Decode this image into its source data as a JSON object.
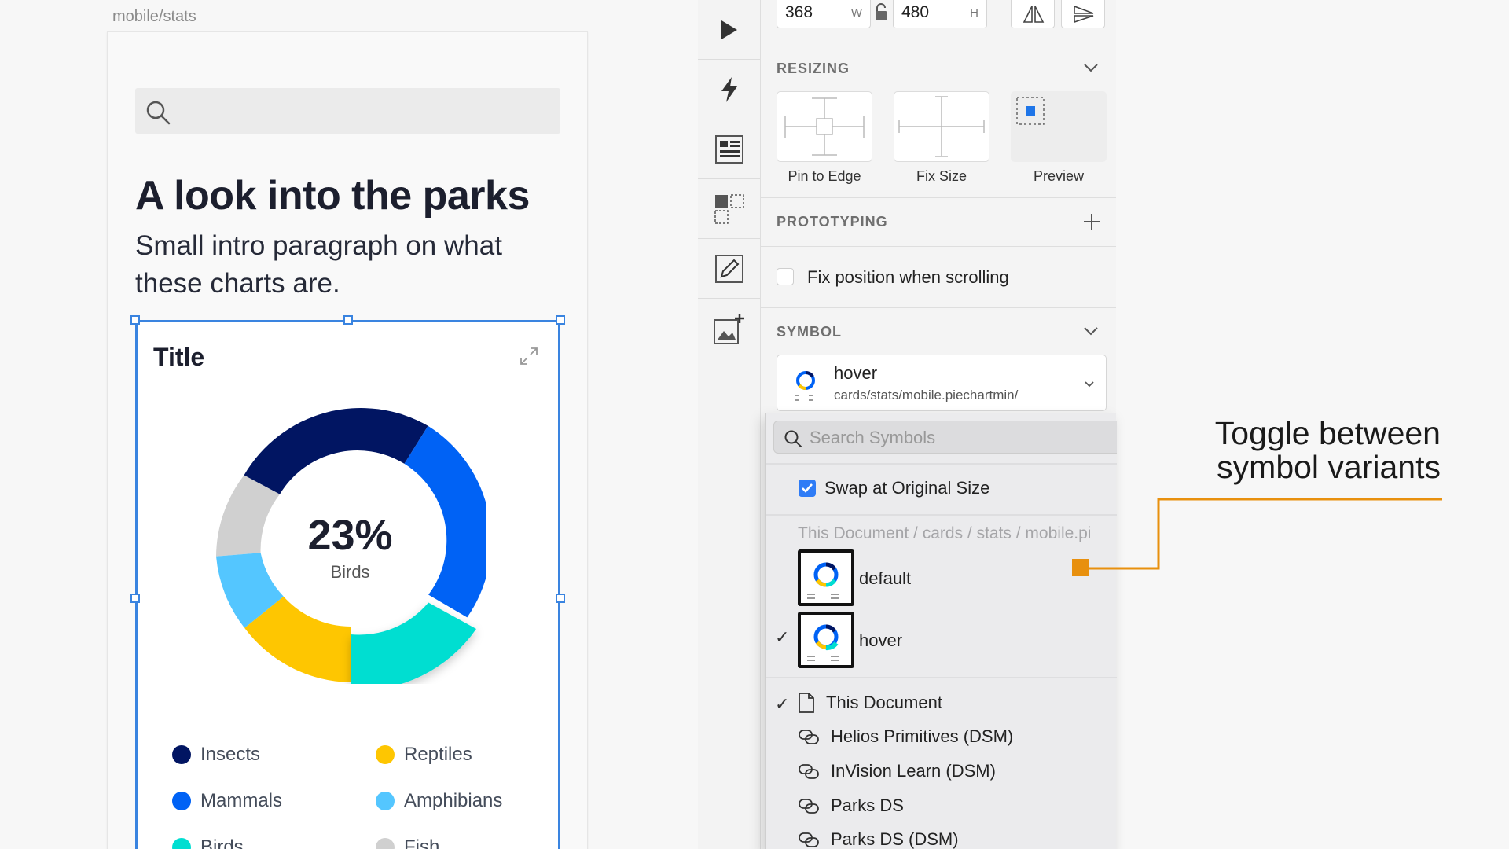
{
  "canvas": {
    "artboard_label": "mobile/stats",
    "page_title": "A look into the parks",
    "page_intro": "Small intro paragraph on what these charts are.",
    "card": {
      "title": "Title",
      "center_value": "23%",
      "center_label": "Birds",
      "legend": [
        {
          "name": "Insects",
          "color": "#011562"
        },
        {
          "name": "Reptiles",
          "color": "#fec601"
        },
        {
          "name": "Mammals",
          "color": "#0062f5"
        },
        {
          "name": "Amphibians",
          "color": "#54c6ff"
        },
        {
          "name": "Birds",
          "color": "#00ded1"
        },
        {
          "name": "Fish",
          "color": "#d0d0d0"
        }
      ]
    }
  },
  "toolbar": {
    "items": [
      {
        "icon": "play-icon"
      },
      {
        "icon": "lightning-icon"
      },
      {
        "icon": "layout-list-icon"
      },
      {
        "icon": "component-icon"
      },
      {
        "icon": "edit-frame-icon"
      },
      {
        "icon": "add-image-icon"
      }
    ]
  },
  "inspector": {
    "width_value": "368",
    "width_suffix": "W",
    "height_value": "480",
    "height_suffix": "H",
    "resizing_title": "RESIZING",
    "resizing_options": [
      "Pin to Edge",
      "Fix Size",
      "Preview"
    ],
    "prototyping_title": "PROTOTYPING",
    "fix_position_label": "Fix position when scrolling",
    "symbol_title": "SYMBOL",
    "symbol_name": "hover",
    "symbol_path": "cards/stats/mobile.piechartmin/"
  },
  "dropdown": {
    "search_placeholder": "Search Symbols",
    "swap_label": "Swap at Original Size",
    "group_path": "This Document / cards / stats / mobile.pi",
    "variants": [
      {
        "name": "default",
        "selected": false
      },
      {
        "name": "hover",
        "selected": true
      }
    ],
    "libraries": [
      {
        "name": "This Document",
        "selected": true,
        "icon": "document-icon"
      },
      {
        "name": "Helios Primitives (DSM)",
        "selected": false,
        "icon": "link-icon"
      },
      {
        "name": "InVision Learn (DSM)",
        "selected": false,
        "icon": "link-icon"
      },
      {
        "name": "Parks DS",
        "selected": false,
        "icon": "link-icon"
      },
      {
        "name": "Parks DS (DSM)",
        "selected": false,
        "icon": "link-icon"
      }
    ]
  },
  "callout": {
    "line1": "Toggle between",
    "line2": "symbol variants",
    "color": "#e8900e"
  }
}
